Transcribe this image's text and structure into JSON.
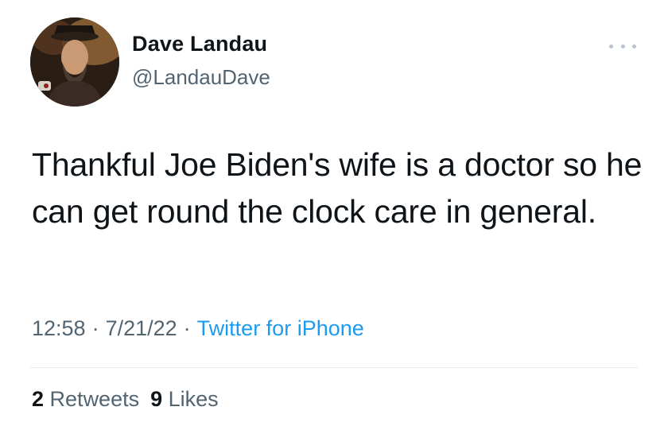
{
  "author": {
    "display_name": "Dave Landau",
    "handle": "@LandauDave",
    "avatar_icon": "profile-photo"
  },
  "more_icon": "ellipsis-icon",
  "tweet": {
    "text": "Thankful Joe Biden's wife is a doctor so he can get round the clock care in general."
  },
  "meta": {
    "time": "12:58",
    "separator": "·",
    "date": "7/21/22",
    "source": "Twitter for iPhone"
  },
  "stats": {
    "retweets_count": "2",
    "retweets_label": "Retweets",
    "likes_count": "9",
    "likes_label": "Likes"
  },
  "colors": {
    "text": "#0f1419",
    "secondary": "#536471",
    "link": "#1d9bf0",
    "divider": "#e6ecf0"
  }
}
